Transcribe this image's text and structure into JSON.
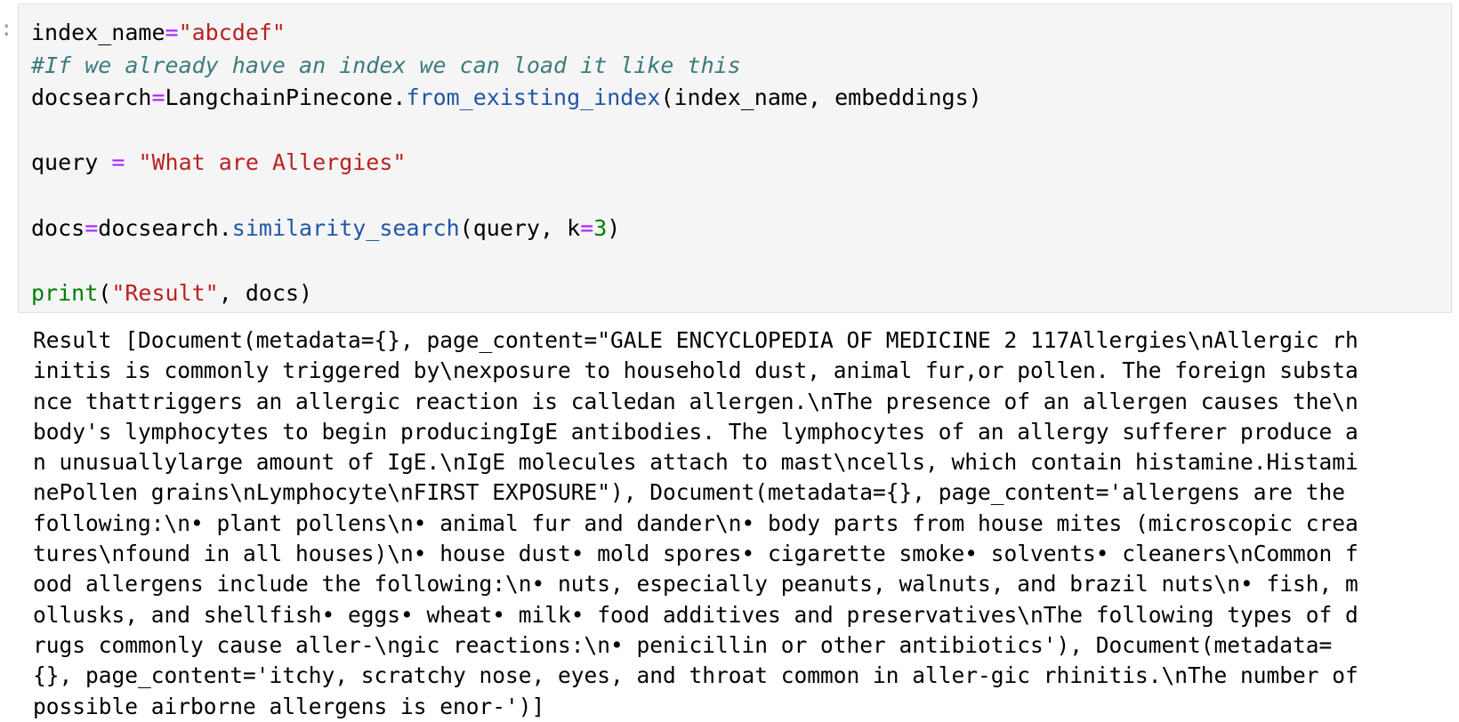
{
  "prompt_marker": ":",
  "code_cell": {
    "line1": {
      "var": "index_name",
      "op": "=",
      "str": "\"abcdef\""
    },
    "line2": {
      "comment": "#If we already have an index we can load it like this"
    },
    "line3": {
      "var": "docsearch",
      "op": "=",
      "obj": "LangchainPinecone.",
      "method": "from_existing_index",
      "args": "(index_name, embeddings)"
    },
    "line5": {
      "var": "query ",
      "op": "=",
      "space": " ",
      "str": "\"What are Allergies\""
    },
    "line7": {
      "var": "docs",
      "op": "=",
      "obj": "docsearch.",
      "method": "similarity_search",
      "args_before": "(query, k",
      "kw_op": "=",
      "num": "3",
      "args_after": ")"
    },
    "line9": {
      "func": "print",
      "open": "(",
      "str": "\"Result\"",
      "rest": ", docs)"
    }
  },
  "output": {
    "lines": [
      "Result [Document(metadata={}, page_content=\"GALE ENCYCLOPEDIA OF MEDICINE 2 117Allergies\\nAllergic rh",
      "initis is commonly triggered by\\nexposure to household dust, animal fur,or pollen. The foreign substa",
      "nce thattriggers an allergic reaction is calledan allergen.\\nThe presence of an allergen causes the\\n",
      "body's lymphocytes to begin producingIgE antibodies. The lymphocytes of an allergy sufferer produce a",
      "n unusuallylarge amount of IgE.\\nIgE molecules attach to mast\\ncells, which contain histamine.Histami",
      "nePollen grains\\nLymphocyte\\nFIRST EXPOSURE\"), Document(metadata={}, page_content='allergens are the",
      "following:\\n• plant pollens\\n• animal fur and dander\\n• body parts from house mites (microscopic crea",
      "tures\\nfound in all houses)\\n• house dust• mold spores• cigarette smoke• solvents• cleaners\\nCommon f",
      "ood allergens include the following:\\n• nuts, especially peanuts, walnuts, and brazil nuts\\n• fish, m",
      "ollusks, and shellfish• eggs• wheat• milk• food additives and preservatives\\nThe following types of d",
      "rugs commonly cause aller-\\ngic reactions:\\n• penicillin or other antibiotics'), Document(metadata=",
      "{}, page_content='itchy, scratchy nose, eyes, and throat common in aller-gic rhinitis.\\nThe number of",
      "possible airborne allergens is enor-')]"
    ]
  }
}
